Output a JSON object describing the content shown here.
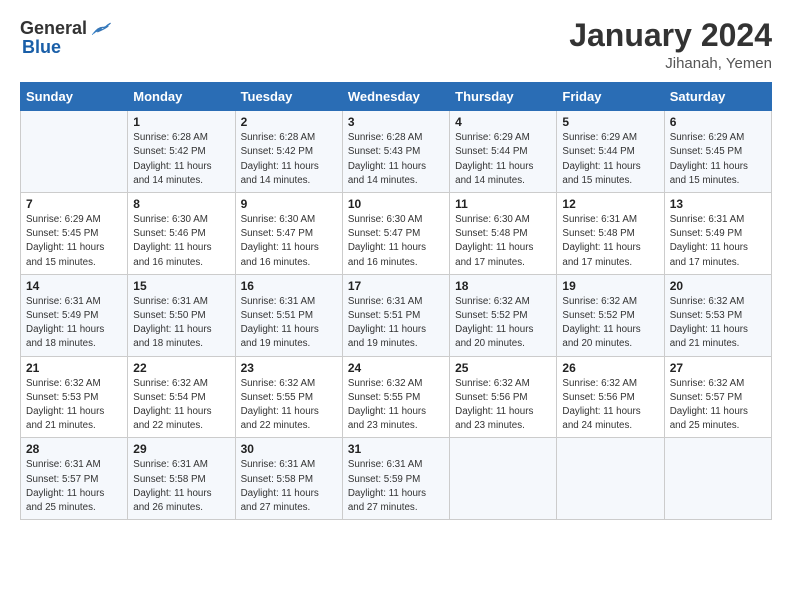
{
  "logo": {
    "general": "General",
    "blue": "Blue"
  },
  "title": "January 2024",
  "location": "Jihanah, Yemen",
  "days_of_week": [
    "Sunday",
    "Monday",
    "Tuesday",
    "Wednesday",
    "Thursday",
    "Friday",
    "Saturday"
  ],
  "weeks": [
    [
      {
        "day": "",
        "info": ""
      },
      {
        "day": "1",
        "info": "Sunrise: 6:28 AM\nSunset: 5:42 PM\nDaylight: 11 hours\nand 14 minutes."
      },
      {
        "day": "2",
        "info": "Sunrise: 6:28 AM\nSunset: 5:42 PM\nDaylight: 11 hours\nand 14 minutes."
      },
      {
        "day": "3",
        "info": "Sunrise: 6:28 AM\nSunset: 5:43 PM\nDaylight: 11 hours\nand 14 minutes."
      },
      {
        "day": "4",
        "info": "Sunrise: 6:29 AM\nSunset: 5:44 PM\nDaylight: 11 hours\nand 14 minutes."
      },
      {
        "day": "5",
        "info": "Sunrise: 6:29 AM\nSunset: 5:44 PM\nDaylight: 11 hours\nand 15 minutes."
      },
      {
        "day": "6",
        "info": "Sunrise: 6:29 AM\nSunset: 5:45 PM\nDaylight: 11 hours\nand 15 minutes."
      }
    ],
    [
      {
        "day": "7",
        "info": "Sunrise: 6:29 AM\nSunset: 5:45 PM\nDaylight: 11 hours\nand 15 minutes."
      },
      {
        "day": "8",
        "info": "Sunrise: 6:30 AM\nSunset: 5:46 PM\nDaylight: 11 hours\nand 16 minutes."
      },
      {
        "day": "9",
        "info": "Sunrise: 6:30 AM\nSunset: 5:47 PM\nDaylight: 11 hours\nand 16 minutes."
      },
      {
        "day": "10",
        "info": "Sunrise: 6:30 AM\nSunset: 5:47 PM\nDaylight: 11 hours\nand 16 minutes."
      },
      {
        "day": "11",
        "info": "Sunrise: 6:30 AM\nSunset: 5:48 PM\nDaylight: 11 hours\nand 17 minutes."
      },
      {
        "day": "12",
        "info": "Sunrise: 6:31 AM\nSunset: 5:48 PM\nDaylight: 11 hours\nand 17 minutes."
      },
      {
        "day": "13",
        "info": "Sunrise: 6:31 AM\nSunset: 5:49 PM\nDaylight: 11 hours\nand 17 minutes."
      }
    ],
    [
      {
        "day": "14",
        "info": "Sunrise: 6:31 AM\nSunset: 5:49 PM\nDaylight: 11 hours\nand 18 minutes."
      },
      {
        "day": "15",
        "info": "Sunrise: 6:31 AM\nSunset: 5:50 PM\nDaylight: 11 hours\nand 18 minutes."
      },
      {
        "day": "16",
        "info": "Sunrise: 6:31 AM\nSunset: 5:51 PM\nDaylight: 11 hours\nand 19 minutes."
      },
      {
        "day": "17",
        "info": "Sunrise: 6:31 AM\nSunset: 5:51 PM\nDaylight: 11 hours\nand 19 minutes."
      },
      {
        "day": "18",
        "info": "Sunrise: 6:32 AM\nSunset: 5:52 PM\nDaylight: 11 hours\nand 20 minutes."
      },
      {
        "day": "19",
        "info": "Sunrise: 6:32 AM\nSunset: 5:52 PM\nDaylight: 11 hours\nand 20 minutes."
      },
      {
        "day": "20",
        "info": "Sunrise: 6:32 AM\nSunset: 5:53 PM\nDaylight: 11 hours\nand 21 minutes."
      }
    ],
    [
      {
        "day": "21",
        "info": "Sunrise: 6:32 AM\nSunset: 5:53 PM\nDaylight: 11 hours\nand 21 minutes."
      },
      {
        "day": "22",
        "info": "Sunrise: 6:32 AM\nSunset: 5:54 PM\nDaylight: 11 hours\nand 22 minutes."
      },
      {
        "day": "23",
        "info": "Sunrise: 6:32 AM\nSunset: 5:55 PM\nDaylight: 11 hours\nand 22 minutes."
      },
      {
        "day": "24",
        "info": "Sunrise: 6:32 AM\nSunset: 5:55 PM\nDaylight: 11 hours\nand 23 minutes."
      },
      {
        "day": "25",
        "info": "Sunrise: 6:32 AM\nSunset: 5:56 PM\nDaylight: 11 hours\nand 23 minutes."
      },
      {
        "day": "26",
        "info": "Sunrise: 6:32 AM\nSunset: 5:56 PM\nDaylight: 11 hours\nand 24 minutes."
      },
      {
        "day": "27",
        "info": "Sunrise: 6:32 AM\nSunset: 5:57 PM\nDaylight: 11 hours\nand 25 minutes."
      }
    ],
    [
      {
        "day": "28",
        "info": "Sunrise: 6:31 AM\nSunset: 5:57 PM\nDaylight: 11 hours\nand 25 minutes."
      },
      {
        "day": "29",
        "info": "Sunrise: 6:31 AM\nSunset: 5:58 PM\nDaylight: 11 hours\nand 26 minutes."
      },
      {
        "day": "30",
        "info": "Sunrise: 6:31 AM\nSunset: 5:58 PM\nDaylight: 11 hours\nand 27 minutes."
      },
      {
        "day": "31",
        "info": "Sunrise: 6:31 AM\nSunset: 5:59 PM\nDaylight: 11 hours\nand 27 minutes."
      },
      {
        "day": "",
        "info": ""
      },
      {
        "day": "",
        "info": ""
      },
      {
        "day": "",
        "info": ""
      }
    ]
  ]
}
